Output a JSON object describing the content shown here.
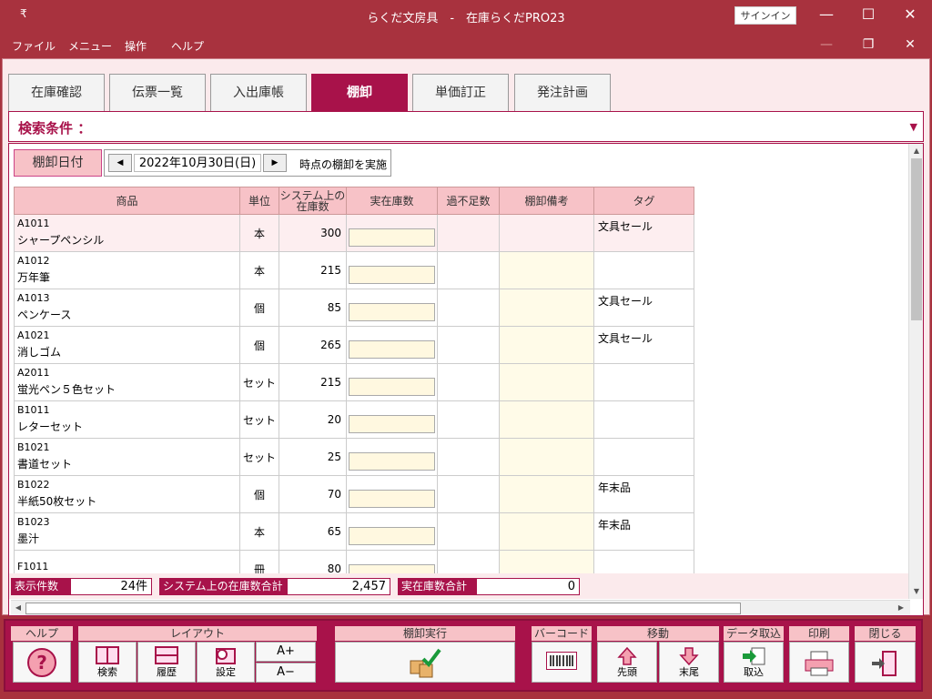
{
  "window": {
    "title": "らくだ文房具　-　在庫らくだPRO23",
    "signin": "サインイン",
    "sysmenu": "₹",
    "minimize": "—",
    "maximize": "☐",
    "close": "✕"
  },
  "menu": [
    "ファイル",
    "メニュー",
    "操作",
    "ヘルプ"
  ],
  "mdi": {
    "minimize": "—",
    "restore": "❐",
    "close": "✕"
  },
  "tabs": [
    "在庫確認",
    "伝票一覧",
    "入出庫帳",
    "棚卸",
    "単価訂正",
    "発注計画"
  ],
  "active_tab": "棚卸",
  "search": {
    "label": "検索条件 ：",
    "arrow": "▼"
  },
  "date": {
    "label": "棚卸日付",
    "prev": "◀",
    "next": "▶",
    "value": "2022年10月30日(日)",
    "suffix": "時点の棚卸を実施"
  },
  "columns": {
    "product": "商品",
    "unit": "単位",
    "system_stock": "システム上の在庫数",
    "actual": "実在庫数",
    "diff": "過不足数",
    "note": "棚卸備考",
    "tag": "タグ"
  },
  "rows": [
    {
      "code": "A1011",
      "name": "シャープペンシル",
      "unit": "本",
      "system": "300",
      "tag": "文具セール"
    },
    {
      "code": "A1012",
      "name": "万年筆",
      "unit": "本",
      "system": "215",
      "tag": ""
    },
    {
      "code": "A1013",
      "name": "ペンケース",
      "unit": "個",
      "system": "85",
      "tag": "文具セール"
    },
    {
      "code": "A1021",
      "name": "消しゴム",
      "unit": "個",
      "system": "265",
      "tag": "文具セール"
    },
    {
      "code": "A2011",
      "name": "蛍光ペン５色セット",
      "unit": "セット",
      "system": "215",
      "tag": ""
    },
    {
      "code": "B1011",
      "name": "レターセット",
      "unit": "セット",
      "system": "20",
      "tag": ""
    },
    {
      "code": "B1021",
      "name": "書道セット",
      "unit": "セット",
      "system": "25",
      "tag": ""
    },
    {
      "code": "B1022",
      "name": "半紙50枚セット",
      "unit": "個",
      "system": "70",
      "tag": "年末品"
    },
    {
      "code": "B1023",
      "name": "墨汁",
      "unit": "本",
      "system": "65",
      "tag": "年末品"
    },
    {
      "code": "F1011",
      "name": "",
      "unit": "冊",
      "system": "80",
      "tag": ""
    }
  ],
  "summary": {
    "count_label": "表示件数",
    "count_value": "24件",
    "system_total_label": "システム上の在庫数合計",
    "system_total_value": "2,457",
    "actual_total_label": "実在庫数合計",
    "actual_total_value": "0"
  },
  "scroll": {
    "up": "▲",
    "down": "▼",
    "left": "◀",
    "right": "▶"
  },
  "footer": {
    "help": {
      "title": "ヘルプ",
      "icon": "?"
    },
    "layout": {
      "title": "レイアウト",
      "search": "検索",
      "history": "履歴",
      "settings": "設定",
      "font_up": "A+",
      "font_down": "A−"
    },
    "execute": {
      "title": "棚卸実行"
    },
    "barcode": {
      "title": "バーコード"
    },
    "move": {
      "title": "移動",
      "first": "先頭",
      "last": "末尾"
    },
    "import": {
      "title": "データ取込",
      "label": "取込"
    },
    "print": {
      "title": "印刷"
    },
    "close": {
      "title": "閉じる"
    }
  },
  "colors": {
    "brand": "#a8323e",
    "accent": "#a8124a",
    "header_pink": "#f7c2c7",
    "input_yellow": "#fff8e0"
  }
}
